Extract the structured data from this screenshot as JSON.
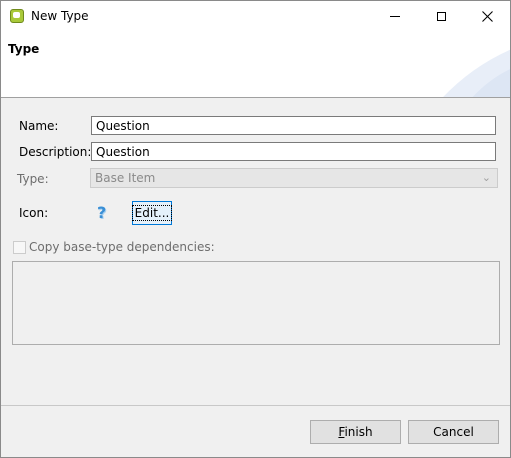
{
  "window": {
    "title": "New Type",
    "app_icon": "app-chat-icon",
    "controls": {
      "minimize": "minimize-icon",
      "maximize": "maximize-icon",
      "close": "close-icon"
    }
  },
  "banner": {
    "title": "Type"
  },
  "form": {
    "name_label": "Name:",
    "name_value": "Question",
    "description_label": "Description:",
    "description_value": "Question",
    "type_label": "Type:",
    "type_value": "Base Item",
    "icon_label": "Icon:",
    "icon_name": "question-mark-icon",
    "edit_button": "Edit...",
    "copy_checkbox_label": "Copy base-type dependencies:",
    "copy_checkbox_checked": false
  },
  "footer": {
    "finish_button_prefix": "F",
    "finish_button_rest": "inish",
    "cancel_button": "Cancel"
  }
}
